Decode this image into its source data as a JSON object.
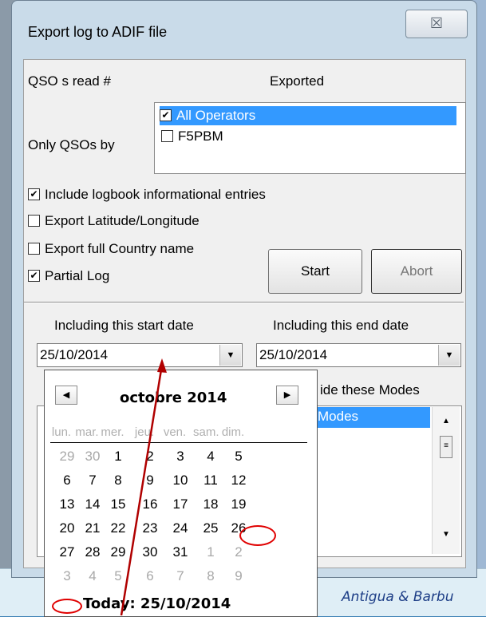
{
  "window": {
    "title": "Export log to ADIF file",
    "close_label": "☒"
  },
  "header": {
    "qso_read_label": "QSO s read #",
    "exported_label": "Exported"
  },
  "operators": {
    "label": "Only QSOs by",
    "items": [
      {
        "name": "All Operators",
        "checked": true,
        "selected": true
      },
      {
        "name": "F5PBM",
        "checked": false,
        "selected": false
      }
    ]
  },
  "options": [
    {
      "label": "Include logbook informational entries",
      "checked": true
    },
    {
      "label": "Export Latitude/Longitude",
      "checked": false
    },
    {
      "label": "Export full Country name",
      "checked": false
    },
    {
      "label": "Partial Log",
      "checked": true
    }
  ],
  "buttons": {
    "start": "Start",
    "abort": "Abort"
  },
  "dates": {
    "start_label": "Including this start date",
    "end_label": "Including this end date",
    "start_value": "25/10/2014",
    "end_value": "25/10/2014"
  },
  "modes": {
    "label_visible": "ide these Modes",
    "selected_visible": "Modes"
  },
  "calendar": {
    "month": "octobre 2014",
    "weekdays": [
      "lun.",
      "mar.",
      "mer.",
      "jeu.",
      "ven.",
      "sam.",
      "dim."
    ],
    "weeks": [
      [
        "29",
        "30",
        "1",
        "2",
        "3",
        "4",
        "5"
      ],
      [
        "6",
        "7",
        "8",
        "9",
        "10",
        "11",
        "12"
      ],
      [
        "13",
        "14",
        "15",
        "16",
        "17",
        "18",
        "19"
      ],
      [
        "20",
        "21",
        "22",
        "23",
        "24",
        "25",
        "26"
      ],
      [
        "27",
        "28",
        "29",
        "30",
        "31",
        "1",
        "2"
      ],
      [
        "3",
        "4",
        "5",
        "6",
        "7",
        "8",
        "9"
      ]
    ],
    "today_label": "Today: 25/10/2014",
    "selected_day": "25"
  },
  "background": {
    "country_text": "Antigua & Barbu"
  },
  "colors": {
    "selection": "#3399ff",
    "annotation": "#e00000"
  }
}
